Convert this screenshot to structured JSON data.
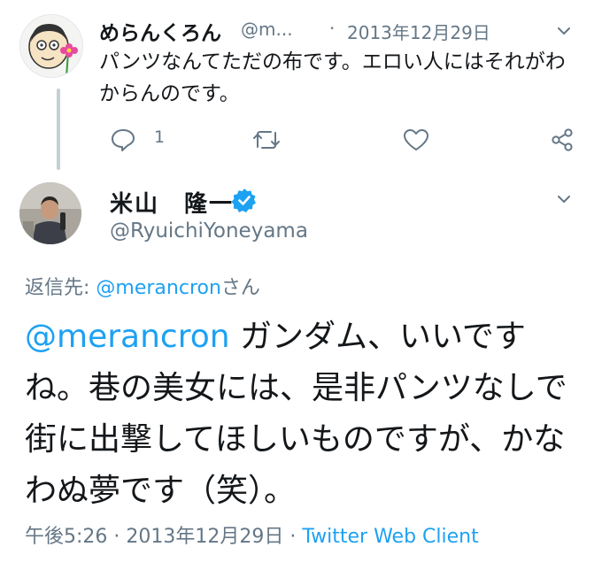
{
  "parent_tweet": {
    "display_name": "めらんくろん",
    "handle": "@m...",
    "separator": "·",
    "date": "2013年12月29日",
    "text": "パンツなんてただの布です。エロい人にはそれがわからんのです。",
    "reply_count": "1",
    "actions": [
      "reply-icon",
      "retweet-icon",
      "like-icon",
      "share-icon"
    ]
  },
  "main_tweet": {
    "display_name": "米山　隆一",
    "handle": "@RyuichiYoneyama",
    "reply_to_label": "返信先: ",
    "reply_to_user": "@merancron",
    "reply_to_suffix": "さん",
    "mention": "@merancron",
    "text": " ガンダム、いいですね。巷の美女には、是非パンツなしで街に出撃してほしいものですが、かなわぬ夢です（笑）。",
    "time": "午後5:26",
    "meta_separator": " · ",
    "date": "2013年12月29日",
    "meta_separator2": " · ",
    "client": "Twitter Web Client"
  },
  "colors": {
    "accent": "#1da1f2",
    "secondary_text": "#657786",
    "primary_text": "#14171a",
    "thread_line": "#c4cfd6"
  }
}
